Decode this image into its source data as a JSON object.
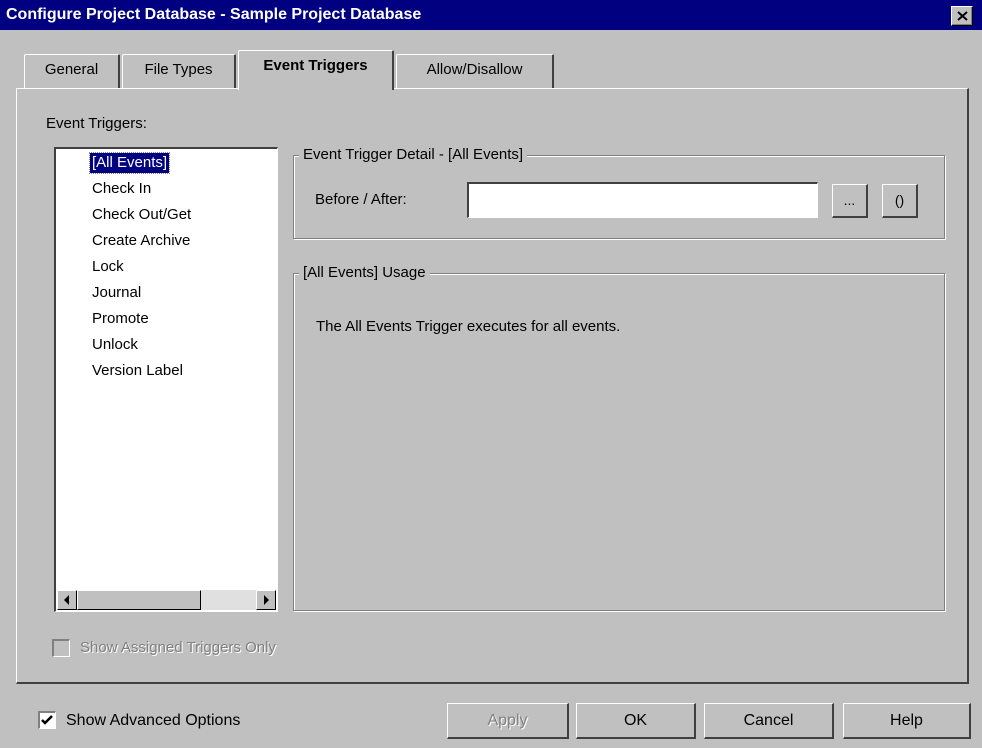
{
  "window": {
    "title": "Configure Project Database - Sample Project Database",
    "close_glyph": "✕"
  },
  "tabs": [
    {
      "label": "General"
    },
    {
      "label": "File Types"
    },
    {
      "label": "Event Triggers",
      "active": true
    },
    {
      "label": "Allow/Disallow"
    }
  ],
  "event_triggers": {
    "label": "Event Triggers:",
    "items": [
      {
        "label": "[All Events]",
        "selected": true
      },
      {
        "label": "Check In"
      },
      {
        "label": "Check Out/Get"
      },
      {
        "label": "Create Archive"
      },
      {
        "label": "Lock"
      },
      {
        "label": "Journal"
      },
      {
        "label": "Promote"
      },
      {
        "label": "Unlock"
      },
      {
        "label": "Version Label"
      }
    ]
  },
  "detail": {
    "legend": "Event Trigger Detail - [All Events]",
    "before_after_label": "Before / After:",
    "before_after_value": "",
    "browse_label": "...",
    "params_label": "()"
  },
  "usage": {
    "legend": "[All Events]  Usage",
    "text": "The All Events Trigger executes for all events."
  },
  "show_assigned_only": {
    "label": "Show Assigned Triggers Only",
    "checked": false,
    "enabled": false
  },
  "show_advanced": {
    "label": "Show Advanced Options",
    "checked": true
  },
  "buttons": {
    "apply": "Apply",
    "ok": "OK",
    "cancel": "Cancel",
    "help": "Help"
  }
}
